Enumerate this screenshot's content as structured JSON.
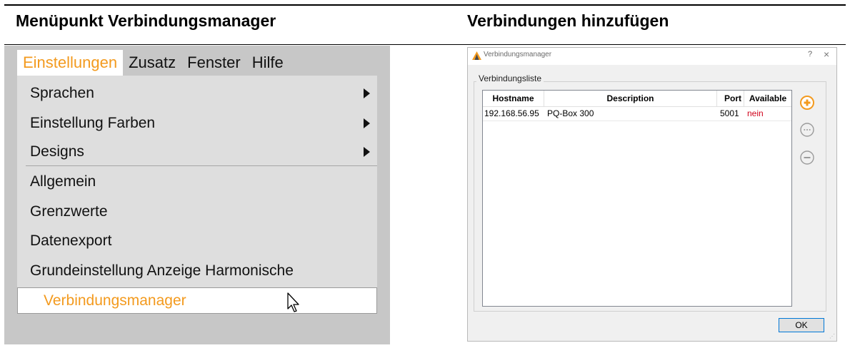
{
  "header": {
    "left_title": "Menüpunkt Verbindungsmanager",
    "right_title": "Verbindungen hinzufügen"
  },
  "menubar": {
    "items": [
      "Einstellungen",
      "Zusatz",
      "Fenster",
      "Hilfe"
    ]
  },
  "dropdown": {
    "items": [
      "Sprachen",
      "Einstellung Farben",
      "Designs",
      "Allgemein",
      "Grenzwerte",
      "Datenexport",
      "Grundeinstellung Anzeige Harmonische",
      "Verbindungsmanager"
    ]
  },
  "dialog": {
    "title": "Verbindungsmanager",
    "help": "?",
    "close": "×",
    "group_label": "Verbindungsliste",
    "columns": [
      "Hostname",
      "Description",
      "Port",
      "Available"
    ],
    "rows": [
      {
        "hostname": "192.168.56.95",
        "description": "PQ-Box 300",
        "port": "5001",
        "available": "nein"
      }
    ],
    "ok_label": "OK"
  },
  "colors": {
    "accent": "#f39a1e",
    "unavailable": "#d0021b"
  },
  "icons": {
    "add": "add-circle-icon",
    "edit": "more-circle-icon",
    "remove": "remove-circle-icon"
  }
}
